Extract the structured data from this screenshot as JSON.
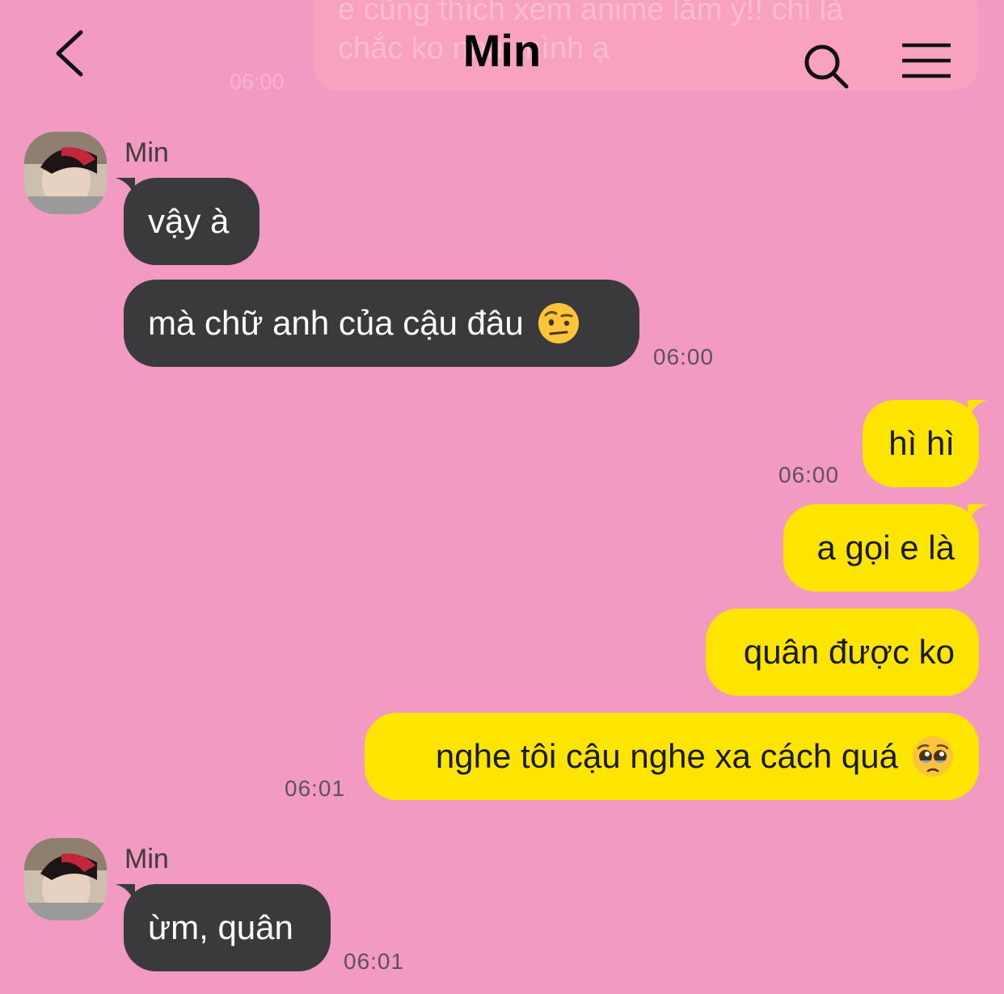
{
  "header": {
    "title": "Min",
    "back_icon": "chevron-left-icon",
    "search_icon": "search-icon",
    "menu_icon": "hamburger-menu-icon"
  },
  "faded_previous": {
    "text": "e cũng thích xem anime lắm ý!! chỉ là\nchắc ko như mình ạ",
    "time": "06:00"
  },
  "messages": [
    {
      "sender": "Min",
      "direction": "in",
      "text": "vậy à",
      "time": ""
    },
    {
      "sender": "Min",
      "direction": "in",
      "text": "mà chữ anh của cậu đâu",
      "emoji": "face-with-raised-eyebrow",
      "time": "06:00"
    },
    {
      "direction": "out",
      "text": "hì hì",
      "time": "06:00"
    },
    {
      "direction": "out",
      "text": "a gọi e là",
      "time": ""
    },
    {
      "direction": "out",
      "text": "quân được ko",
      "time": ""
    },
    {
      "direction": "out",
      "text": "nghe tôi cậu nghe xa cách quá",
      "emoji": "pleading-face",
      "time": "06:01"
    },
    {
      "sender": "Min",
      "direction": "in",
      "text": "ừm, quân",
      "time": "06:01"
    }
  ],
  "colors": {
    "background": "#F29AC1",
    "incoming_bubble": "#3A3A3C",
    "outgoing_bubble": "#FEE500"
  }
}
